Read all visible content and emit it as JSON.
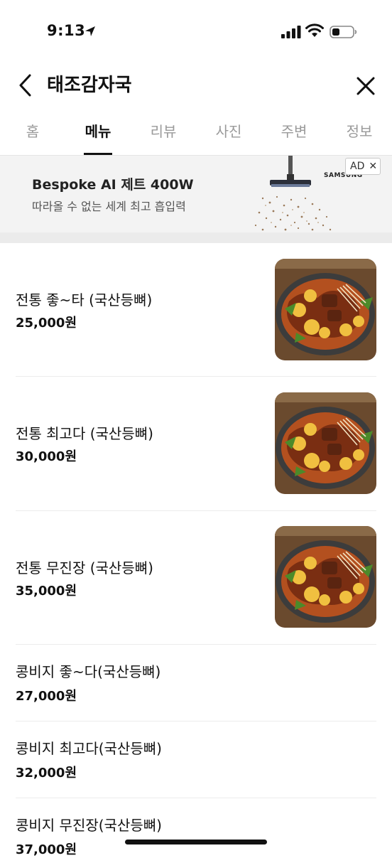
{
  "status_bar": {
    "time": "9:13",
    "icons": [
      "location-arrow-icon",
      "signal-icon",
      "wifi-icon",
      "battery-icon"
    ]
  },
  "header": {
    "title": "태조감자국",
    "back_icon": "chevron-left-icon",
    "close_icon": "close-icon"
  },
  "tabs": [
    {
      "label": "홈",
      "active": false
    },
    {
      "label": "메뉴",
      "active": true
    },
    {
      "label": "리뷰",
      "active": false
    },
    {
      "label": "사진",
      "active": false
    },
    {
      "label": "주변",
      "active": false
    },
    {
      "label": "정보",
      "active": false
    }
  ],
  "ad": {
    "title": "Bespoke AI 제트 400W",
    "subtitle": "따라올 수 없는 세계 최고 흡입력",
    "brand": "SAMSUNG",
    "badge": "AD",
    "badge_close": "✕"
  },
  "menu": {
    "items": [
      {
        "name": "전통 좋~타 (국산등뼈)",
        "price": "25,000원",
        "has_photo": true
      },
      {
        "name": "전통 최고다 (국산등뼈)",
        "price": "30,000원",
        "has_photo": true
      },
      {
        "name": "전통 무진장 (국산등뼈)",
        "price": "35,000원",
        "has_photo": true
      },
      {
        "name": "콩비지 좋~다(국산등뼈)",
        "price": "27,000원",
        "has_photo": false
      },
      {
        "name": "콩비지 최고다(국산등뼈)",
        "price": "32,000원",
        "has_photo": false
      },
      {
        "name": "콩비지 무진장(국산등뼈)",
        "price": "37,000원",
        "has_photo": false
      }
    ]
  },
  "colors": {
    "text": "#111111",
    "tab_inactive": "#9a9a9a",
    "ad_bg": "#f3f3f3",
    "divider": "#ececec"
  }
}
